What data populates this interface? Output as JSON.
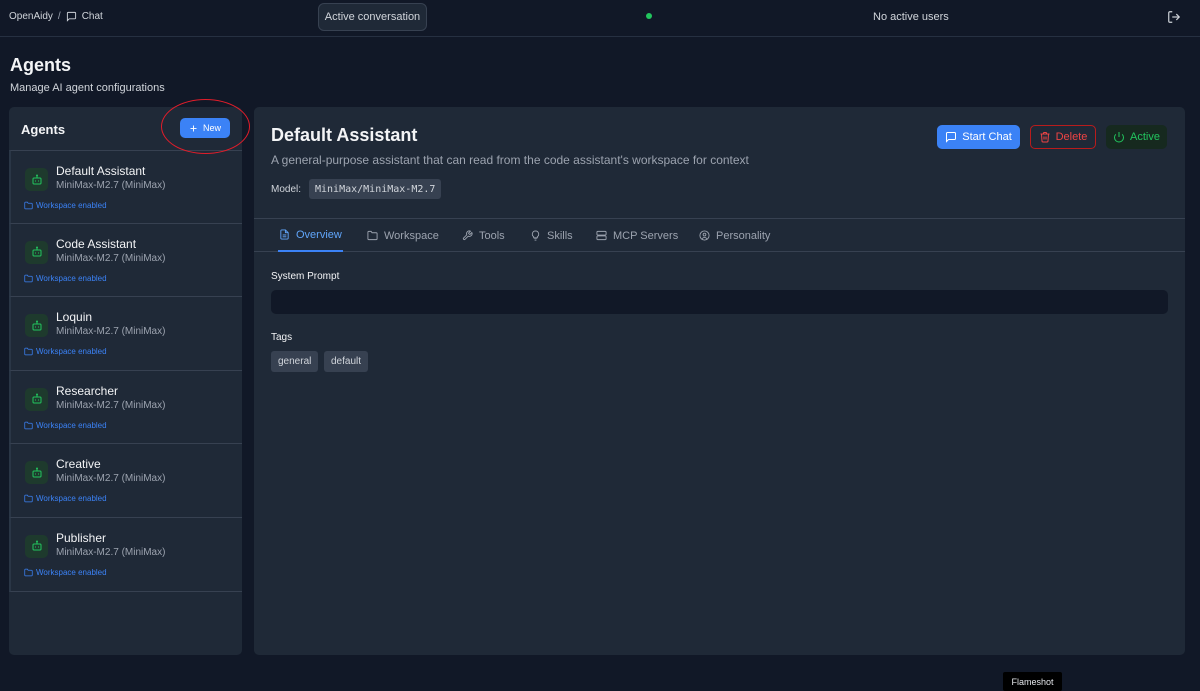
{
  "topbar": {
    "app_name": "OpenAidy",
    "separator": "/",
    "section": "Chat",
    "conversation_button": "Active conversation",
    "users_status": "No active users"
  },
  "page": {
    "title": "Agents",
    "subtitle": "Manage AI agent configurations"
  },
  "sidebar": {
    "title": "Agents",
    "new_label": "New",
    "agents": [
      {
        "name": "Default Assistant",
        "model": "MiniMax-M2.7 (MiniMax)",
        "workspace": "Workspace enabled"
      },
      {
        "name": "Code Assistant",
        "model": "MiniMax-M2.7 (MiniMax)",
        "workspace": "Workspace enabled"
      },
      {
        "name": "Loquin",
        "model": "MiniMax-M2.7 (MiniMax)",
        "workspace": "Workspace enabled"
      },
      {
        "name": "Researcher",
        "model": "MiniMax-M2.7 (MiniMax)",
        "workspace": "Workspace enabled"
      },
      {
        "name": "Creative",
        "model": "MiniMax-M2.7 (MiniMax)",
        "workspace": "Workspace enabled"
      },
      {
        "name": "Publisher",
        "model": "MiniMax-M2.7 (MiniMax)",
        "workspace": "Workspace enabled"
      }
    ]
  },
  "detail": {
    "title": "Default Assistant",
    "description": "A general-purpose assistant that can read from the code assistant's workspace for context",
    "model_label": "Model:",
    "model_value": "MiniMax/MiniMax-M2.7",
    "start_chat_label": "Start Chat",
    "delete_label": "Delete",
    "status_label": "Active",
    "tabs": [
      {
        "label": "Overview",
        "icon": "document-icon"
      },
      {
        "label": "Workspace",
        "icon": "folder-icon"
      },
      {
        "label": "Tools",
        "icon": "wrench-icon"
      },
      {
        "label": "Skills",
        "icon": "lightbulb-icon"
      },
      {
        "label": "MCP Servers",
        "icon": "server-icon"
      },
      {
        "label": "Personality",
        "icon": "user-circle-icon"
      }
    ],
    "active_tab": "Overview",
    "system_prompt_label": "System Prompt",
    "system_prompt_value": "",
    "tags_label": "Tags",
    "tags": [
      "general",
      "default"
    ]
  },
  "tooltip": "Flameshot",
  "colors": {
    "background": "#111827",
    "panel": "#1f2937",
    "accent": "#3b82f6",
    "danger": "#ef4444",
    "success": "#22c55e",
    "annotation": "#e11d2a"
  }
}
